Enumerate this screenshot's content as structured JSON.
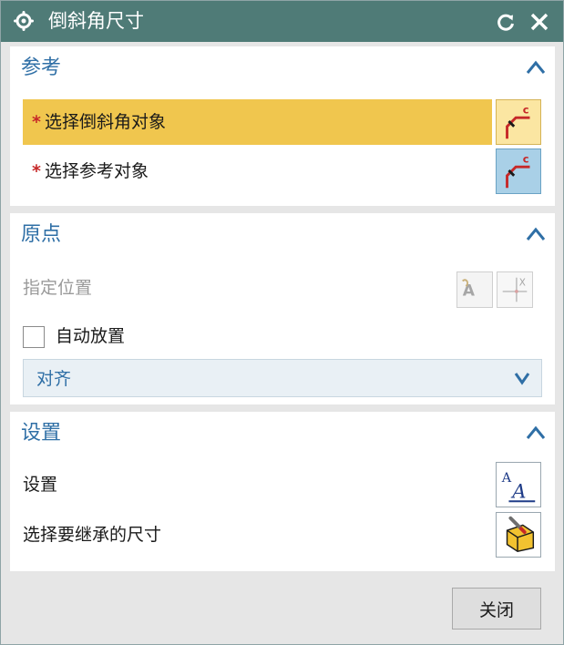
{
  "window": {
    "title": "倒斜角尺寸",
    "icons": {
      "title": "gear-icon",
      "reset": "reset-icon",
      "close": "close-icon"
    }
  },
  "sections": {
    "reference": {
      "title": "参考",
      "select_chamfer_object": "选择倒斜角对象",
      "select_reference_object": "选择参考对象",
      "required_marker": "*",
      "chamfer_button_icon": "chamfer-select-icon",
      "reference_button_icon": "chamfer-reference-icon"
    },
    "origin": {
      "title": "原点",
      "specify_location": "指定位置",
      "auto_place_label": "自动放置",
      "auto_place_checked": false,
      "alignment_value": "对齐",
      "text_origin_icon": "text-origin-icon",
      "point_dialog_icon": "point-dialog-icon"
    },
    "settings": {
      "title": "设置",
      "settings_label": "设置",
      "inherit_label": "选择要继承的尺寸",
      "settings_icon": "text-style-icon",
      "inherit_icon": "inherit-dimension-icon"
    }
  },
  "footer": {
    "close_label": "关闭"
  },
  "colors": {
    "titlebar": "#4f7b77",
    "section_header": "#2f6fa6",
    "active_row": "#f0c64e",
    "required": "#c62828"
  }
}
